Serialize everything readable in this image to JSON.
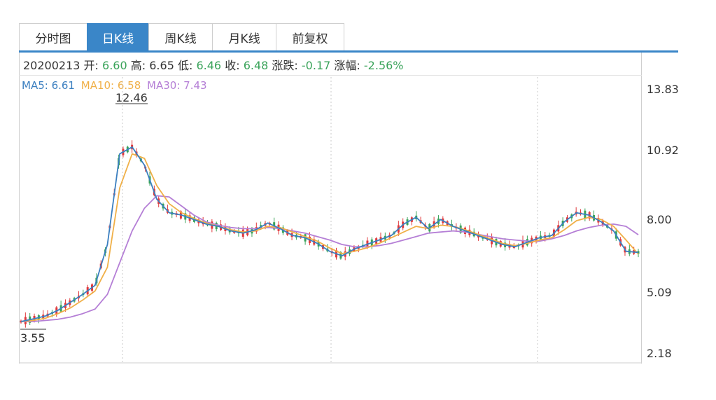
{
  "tabs": [
    {
      "label": "分时图",
      "active": false
    },
    {
      "label": "日K线",
      "active": true
    },
    {
      "label": "周K线",
      "active": false
    },
    {
      "label": "月K线",
      "active": false
    },
    {
      "label": "前复权",
      "active": false
    }
  ],
  "info": {
    "date": "20200213",
    "open_label": "开:",
    "open": "6.60",
    "high_label": "高:",
    "high": "6.65",
    "low_label": "低:",
    "low": "6.46",
    "close_label": "收:",
    "close": "6.48",
    "change_label": "涨跌:",
    "change": "-0.17",
    "pct_label": "涨幅:",
    "pct": "-2.56%"
  },
  "ma": {
    "ma5": "MA5: 6.61",
    "ma10": "MA10: 6.58",
    "ma30": "MA30: 7.43"
  },
  "colors": {
    "accent": "#3a86c8",
    "up": "#e0393c",
    "down": "#3aa35a",
    "ma5": "#3b7fc0",
    "ma10": "#f0b048",
    "ma30": "#b57fd6"
  },
  "chart_data": {
    "type": "candlestick",
    "y_tick_labels": [
      "13.83",
      "10.92",
      "8.00",
      "5.09",
      "2.18"
    ],
    "ylim": [
      2.18,
      13.83
    ],
    "max_label": "12.46",
    "min_label": "3.55",
    "grid": "vertical dotted",
    "ma5": [
      3.6,
      3.72,
      3.85,
      4.1,
      4.45,
      4.8,
      5.2,
      7.0,
      11.0,
      11.3,
      10.5,
      9.0,
      8.4,
      8.3,
      8.1,
      7.9,
      7.8,
      7.6,
      7.5,
      7.65,
      7.95,
      7.7,
      7.4,
      7.3,
      7.05,
      6.7,
      6.5,
      6.8,
      7.0,
      7.2,
      7.4,
      7.9,
      8.2,
      7.7,
      8.1,
      7.8,
      7.6,
      7.4,
      7.2,
      7.0,
      6.9,
      7.1,
      7.3,
      7.4,
      8.0,
      8.4,
      8.3,
      8.0,
      7.6,
      6.7,
      6.65
    ],
    "ma10": [
      3.6,
      3.65,
      3.75,
      3.95,
      4.2,
      4.55,
      4.95,
      6.0,
      9.5,
      11.0,
      10.8,
      9.6,
      8.8,
      8.4,
      8.15,
      7.95,
      7.8,
      7.65,
      7.55,
      7.6,
      7.8,
      7.75,
      7.55,
      7.35,
      7.15,
      6.85,
      6.6,
      6.7,
      6.85,
      7.05,
      7.3,
      7.55,
      7.8,
      7.7,
      7.85,
      7.8,
      7.65,
      7.45,
      7.25,
      7.05,
      6.95,
      7.05,
      7.2,
      7.3,
      7.65,
      8.05,
      8.2,
      8.1,
      7.8,
      7.2,
      6.58
    ],
    "ma30": [
      3.6,
      3.6,
      3.65,
      3.7,
      3.8,
      3.95,
      4.15,
      4.8,
      6.2,
      7.6,
      8.6,
      9.15,
      9.1,
      8.7,
      8.3,
      8.0,
      7.85,
      7.75,
      7.7,
      7.7,
      7.75,
      7.7,
      7.6,
      7.5,
      7.35,
      7.2,
      7.0,
      6.9,
      6.9,
      6.95,
      7.05,
      7.2,
      7.35,
      7.5,
      7.55,
      7.6,
      7.55,
      7.45,
      7.35,
      7.25,
      7.2,
      7.15,
      7.15,
      7.25,
      7.4,
      7.6,
      7.75,
      7.85,
      7.9,
      7.8,
      7.43
    ]
  }
}
